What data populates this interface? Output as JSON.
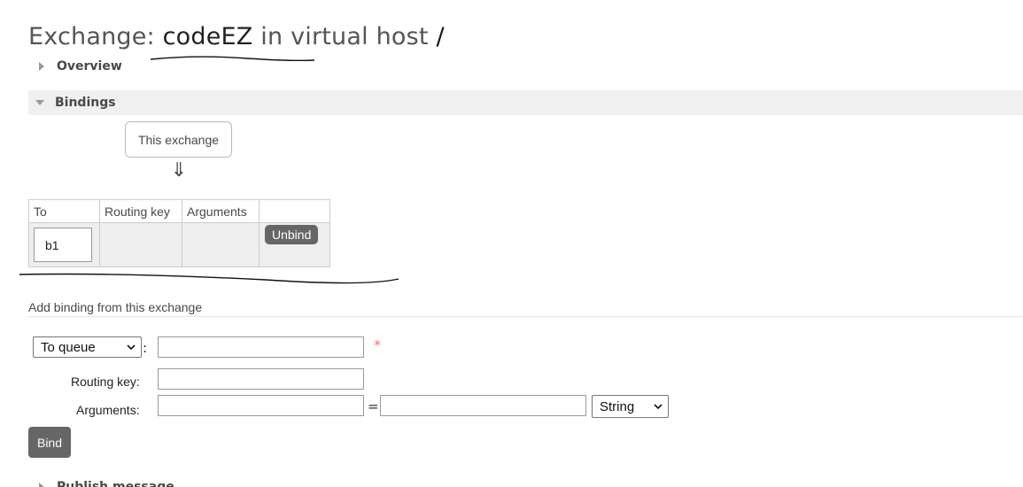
{
  "title": {
    "prefix": "Exchange: ",
    "exchange_name": "codeEZ",
    "vhost_text": " in virtual host ",
    "vhost": "/"
  },
  "sections": {
    "overview": {
      "label": "Overview",
      "state": "collapsed"
    },
    "bindings": {
      "label": "Bindings",
      "state": "expanded"
    },
    "publish": {
      "label": "Publish message",
      "state": "collapsed"
    }
  },
  "bindings": {
    "source_label": "This exchange",
    "arrow": "⇓",
    "columns": [
      "To",
      "Routing key",
      "Arguments",
      ""
    ],
    "rows": [
      {
        "to": "b1",
        "routing_key": "",
        "arguments": "",
        "action": "Unbind"
      }
    ]
  },
  "add_binding": {
    "heading": "Add binding from this exchange",
    "destination_type": "To queue",
    "destination_colon": ":",
    "destination_value": "",
    "required_marker": "*",
    "routing_key_label": "Routing key:",
    "routing_key_value": "",
    "arguments_label": "Arguments:",
    "argument_key": "",
    "equals": "=",
    "argument_value": "",
    "argument_type": "String",
    "submit_label": "Bind"
  },
  "colors": {
    "button_bg": "#666666",
    "section_bg": "#f0f0f0",
    "table_cell_bg": "#eeeeee",
    "required": "#ff6b6b"
  }
}
